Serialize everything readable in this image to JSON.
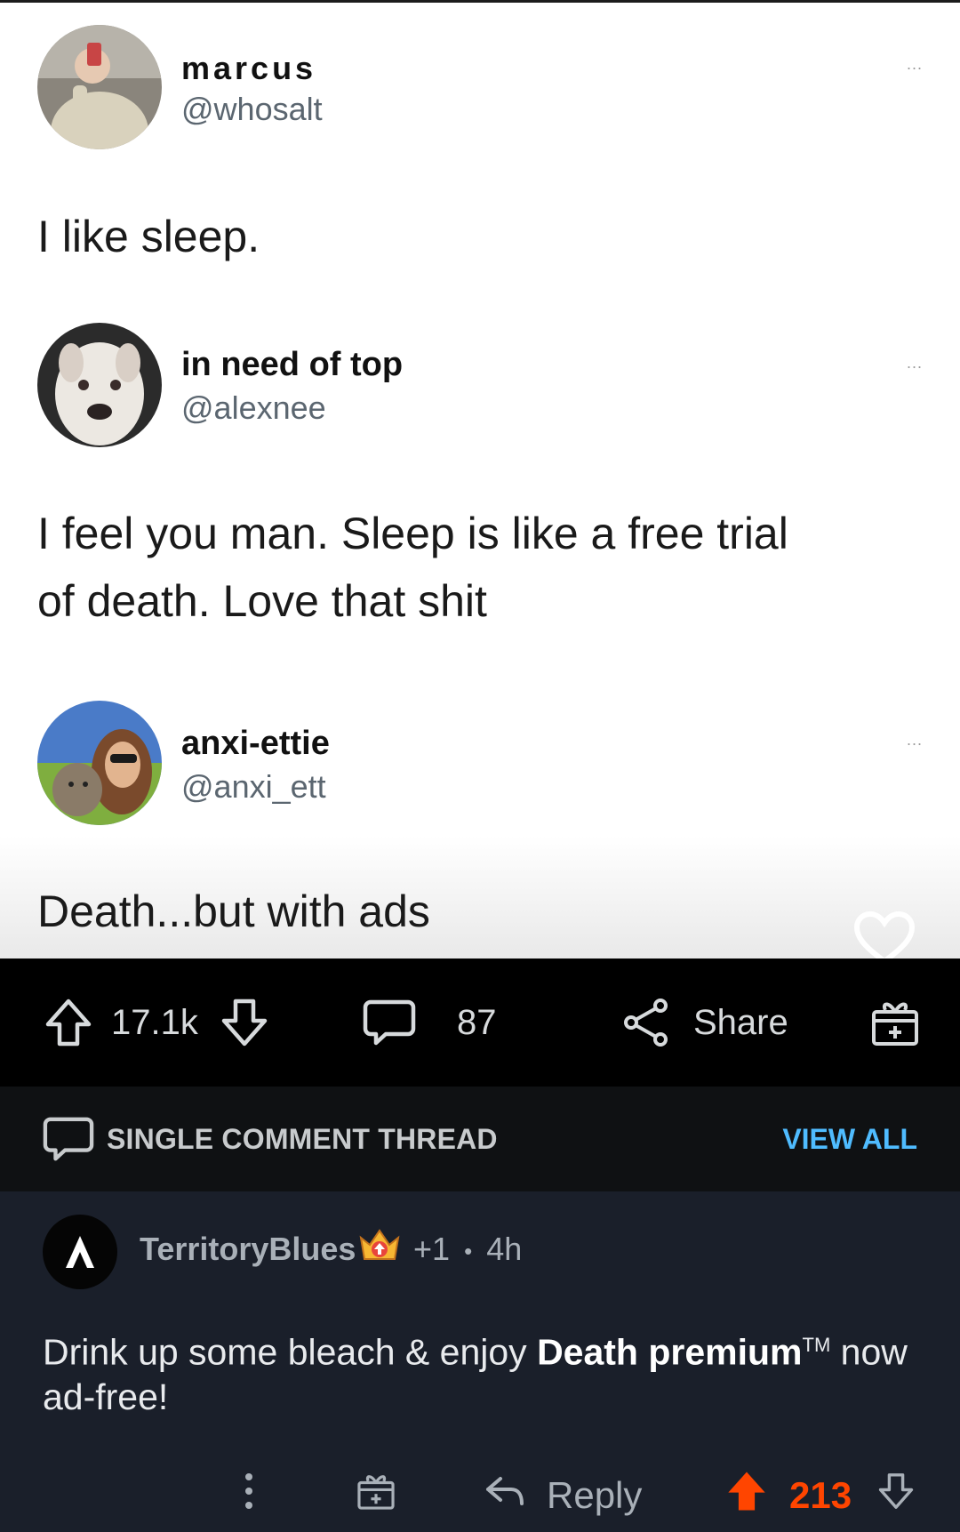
{
  "tweets": [
    {
      "display_name": "marcus",
      "handle": "@whosalt",
      "text": "I like sleep.",
      "more": "..."
    },
    {
      "display_name": "in need of top",
      "handle": "@alexnee",
      "text_line1": "I feel you man. Sleep is like a free trial",
      "text_line2": "of death. Love that shit",
      "more": "..."
    },
    {
      "display_name": "anxi-ettie",
      "handle": "@anxi_ett",
      "text": "Death...but with ads",
      "more": "..."
    }
  ],
  "post_actions": {
    "upvotes": "17.1k",
    "comments": "87",
    "share_label": "Share"
  },
  "thread": {
    "label": "SINGLE COMMENT THREAD",
    "view_all": "VIEW ALL"
  },
  "comment": {
    "username": "TerritoryBlues",
    "award_count": "+1",
    "separator": "•",
    "age": "4h",
    "body_start": "Drink up some bleach & enjoy ",
    "body_bold": "Death premium",
    "body_tm": "TM",
    "body_end": " now ad-free!",
    "reply_label": "Reply",
    "score": "213"
  },
  "colors": {
    "upvote_active": "#ff4500",
    "link_blue": "#4fbcff"
  },
  "icons": [
    "more-dots-icon",
    "heart-icon",
    "upvote-icon",
    "downvote-icon",
    "comment-icon",
    "share-icon",
    "award-icon",
    "overflow-icon",
    "reply-icon"
  ]
}
